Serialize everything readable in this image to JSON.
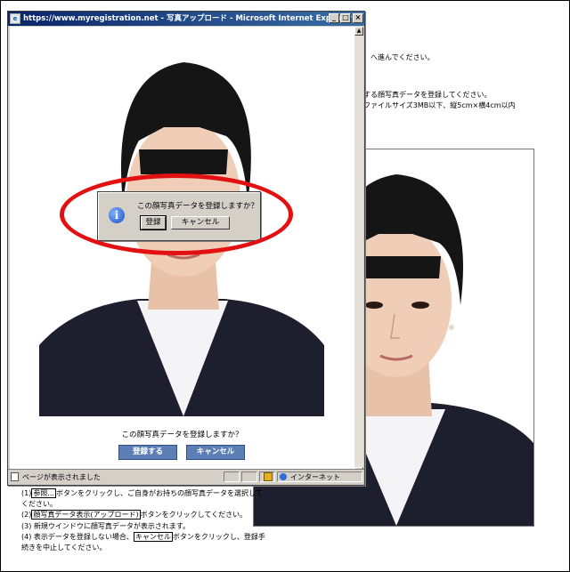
{
  "background_page": {
    "line1": "）へ進んでください。",
    "line2": "する顔写真データを登録してください。",
    "line3": "ファイルサイズ3MB以下、縦5cm×横4cm以内"
  },
  "ie_window": {
    "title": "https://www.myregistration.net - 写真アップロード - Microsoft Internet Explorer",
    "controls": {
      "minimize": "_",
      "maximize": "□",
      "close": "×"
    },
    "photo_question": "この顔写真データを登録しますか？",
    "register_button": "登録する",
    "cancel_button": "キャンセル",
    "status_text": "ページが表示されました",
    "zone_text": "インターネット"
  },
  "message_box": {
    "icon": "info-icon",
    "text": "この顔写真データを登録しますか？",
    "ok_button": "登録",
    "cancel_button": "キャンセル"
  },
  "annotation_color": "#e21010",
  "steps": {
    "s1_a": "(1)",
    "s1_btn": "参照...",
    "s1_b": "ボタンをクリックし、ご自身がお持ちの顔写真データを選択して",
    "s1_c": "ください。",
    "s2_a": "(2)",
    "s2_btn": "顔写真データ表示(アップロード)",
    "s2_b": "ボタンをクリックしてください。",
    "s3": "(3) 新規ウインドウに顔写真データが表示されます。",
    "s4_a": "(4) 表示データを登録しない場合、",
    "s4_btn": "キャンセル",
    "s4_b": "ボタンをクリックし、登録手",
    "s4_c": "続きを中止してください。"
  }
}
